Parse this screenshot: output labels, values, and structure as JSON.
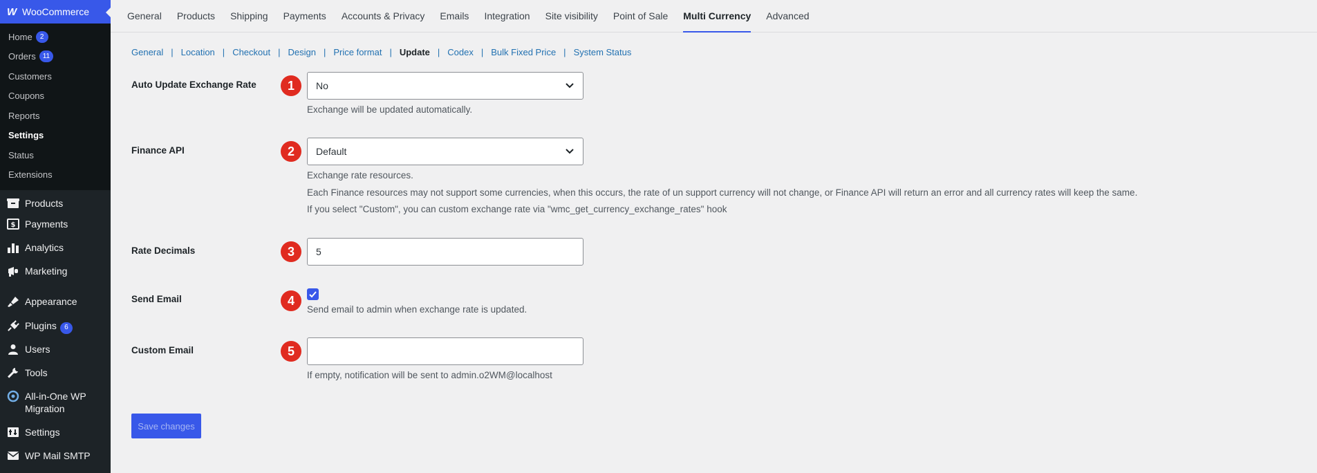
{
  "sidebar": {
    "brand": "WooCommerce",
    "submenu": [
      {
        "label": "Home",
        "badge": "2"
      },
      {
        "label": "Orders",
        "badge": "11"
      },
      {
        "label": "Customers"
      },
      {
        "label": "Coupons"
      },
      {
        "label": "Reports"
      },
      {
        "label": "Settings"
      },
      {
        "label": "Status"
      },
      {
        "label": "Extensions"
      }
    ],
    "menu": [
      {
        "label": "Products",
        "icon": "products-icon"
      },
      {
        "label": "Payments",
        "icon": "payments-icon"
      },
      {
        "label": "Analytics",
        "icon": "analytics-icon"
      },
      {
        "label": "Marketing",
        "icon": "marketing-icon"
      },
      {
        "label": "Appearance",
        "icon": "appearance-icon"
      },
      {
        "label": "Plugins",
        "icon": "plugins-icon",
        "badge": "6"
      },
      {
        "label": "Users",
        "icon": "users-icon"
      },
      {
        "label": "Tools",
        "icon": "tools-icon"
      },
      {
        "label": "All-in-One WP Migration",
        "icon": "migration-icon"
      },
      {
        "label": "Settings",
        "icon": "settings-icon"
      },
      {
        "label": "WP Mail SMTP",
        "icon": "mail-icon"
      }
    ]
  },
  "tabs": [
    "General",
    "Products",
    "Shipping",
    "Payments",
    "Accounts & Privacy",
    "Emails",
    "Integration",
    "Site visibility",
    "Point of Sale",
    "Multi Currency",
    "Advanced"
  ],
  "subnav": [
    "General",
    "Location",
    "Checkout",
    "Design",
    "Price format",
    "Update",
    "Codex",
    "Bulk Fixed Price",
    "System Status"
  ],
  "form": {
    "auto_update": {
      "label": "Auto Update Exchange Rate",
      "step": "1",
      "value": "No",
      "desc": "Exchange will be updated automatically."
    },
    "finance_api": {
      "label": "Finance API",
      "step": "2",
      "value": "Default",
      "desc1": "Exchange rate resources.",
      "desc2": "Each Finance resources may not support some currencies, when this occurs, the rate of un support currency will not change, or Finance API will return an error and all currency rates will keep the same.",
      "desc3": "If you select \"Custom\", you can custom exchange rate via \"wmc_get_currency_exchange_rates\" hook"
    },
    "rate_decimals": {
      "label": "Rate Decimals",
      "step": "3",
      "value": "5"
    },
    "send_email": {
      "label": "Send Email",
      "step": "4",
      "checked": true,
      "desc": "Send email to admin when exchange rate is updated."
    },
    "custom_email": {
      "label": "Custom Email",
      "step": "5",
      "value": "",
      "desc": "If empty, notification will be sent to admin.o2WM@localhost"
    }
  },
  "save_label": "Save changes",
  "colors": {
    "accent": "#3858e9",
    "step": "#e02b20",
    "sidebar": "#1d2327"
  }
}
